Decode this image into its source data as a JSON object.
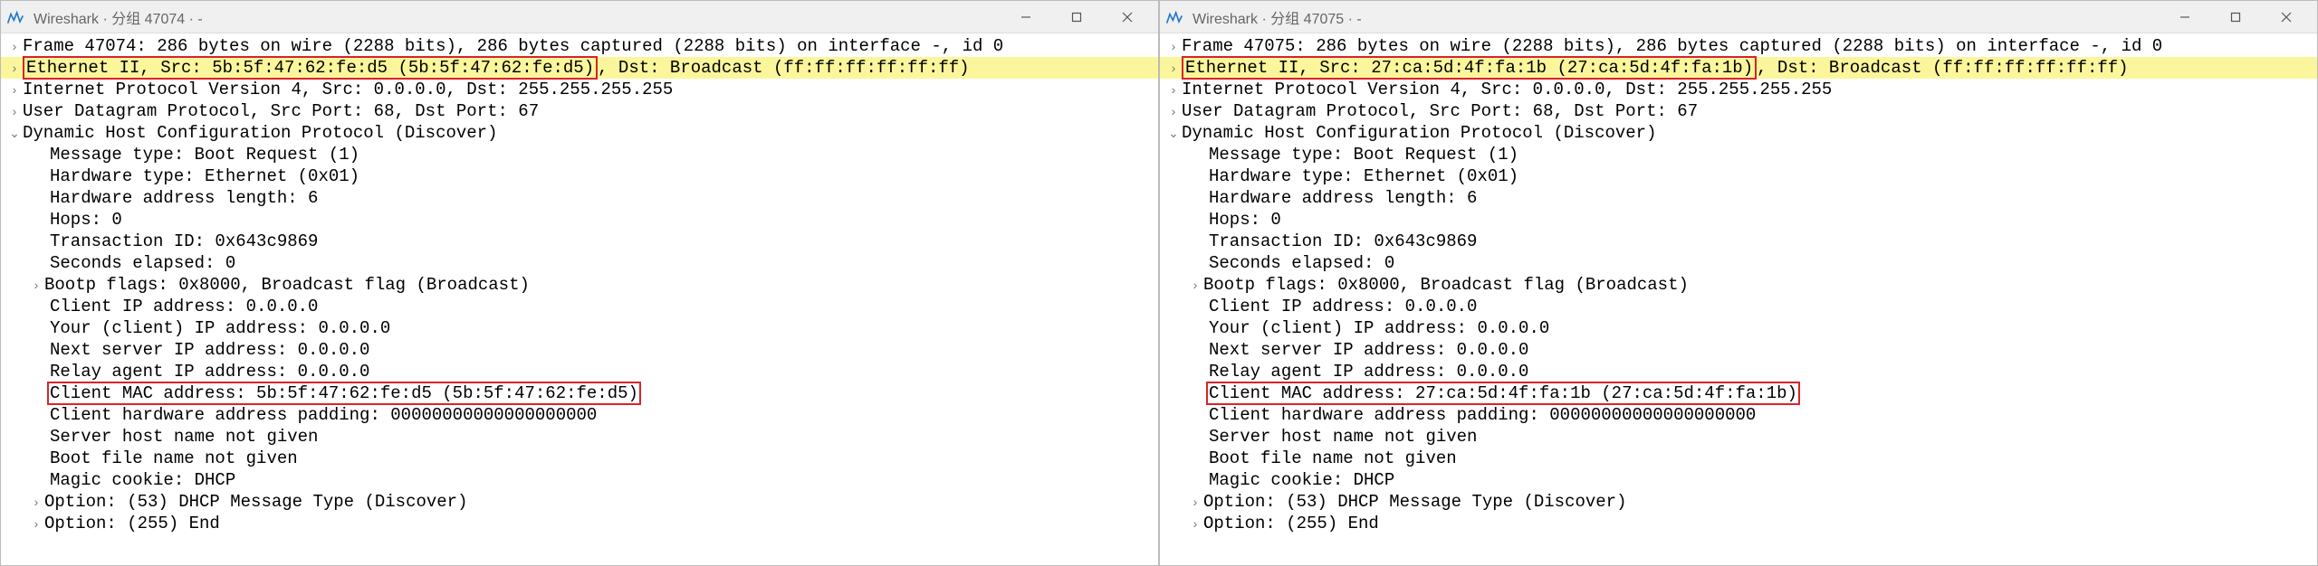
{
  "left": {
    "title": "Wireshark · 分组 47074 · -",
    "frame_line": "Frame 47074: 286 bytes on wire (2288 bits), 286 bytes captured (2288 bits) on interface -, id 0",
    "eth_prefix": "Ethernet II, Src: 5b:5f:47:62:fe:d5 (5b:5f:47:62:fe:d5)",
    "eth_suffix": ", Dst: Broadcast (ff:ff:ff:ff:ff:ff)",
    "ip_line": "Internet Protocol Version 4, Src: 0.0.0.0, Dst: 255.255.255.255",
    "udp_line": "User Datagram Protocol, Src Port: 68, Dst Port: 67",
    "dhcp_header": "Dynamic Host Configuration Protocol (Discover)",
    "msg_type": "Message type: Boot Request (1)",
    "hw_type": "Hardware type: Ethernet (0x01)",
    "hw_len": "Hardware address length: 6",
    "hops": "Hops: 0",
    "tx_id": "Transaction ID: 0x643c9869",
    "secs": "Seconds elapsed: 0",
    "bootp": "Bootp flags: 0x8000, Broadcast flag (Broadcast)",
    "client_ip": "Client IP address: 0.0.0.0",
    "your_ip": "Your (client) IP address: 0.0.0.0",
    "next_ip": "Next server IP address: 0.0.0.0",
    "relay_ip": "Relay agent IP address: 0.0.0.0",
    "client_mac": "Client MAC address: 5b:5f:47:62:fe:d5 (5b:5f:47:62:fe:d5)",
    "hw_pad": "Client hardware address padding: 00000000000000000000",
    "server_host": "Server host name not given",
    "boot_file": "Boot file name not given",
    "magic": "Magic cookie: DHCP",
    "opt53": "Option: (53) DHCP Message Type (Discover)",
    "opt255": "Option: (255) End"
  },
  "right": {
    "title": "Wireshark · 分组 47075 · -",
    "frame_line": "Frame 47075: 286 bytes on wire (2288 bits), 286 bytes captured (2288 bits) on interface -, id 0",
    "eth_prefix": "Ethernet II, Src: 27:ca:5d:4f:fa:1b (27:ca:5d:4f:fa:1b)",
    "eth_suffix": ", Dst: Broadcast (ff:ff:ff:ff:ff:ff)",
    "ip_line": "Internet Protocol Version 4, Src: 0.0.0.0, Dst: 255.255.255.255",
    "udp_line": "User Datagram Protocol, Src Port: 68, Dst Port: 67",
    "dhcp_header": "Dynamic Host Configuration Protocol (Discover)",
    "msg_type": "Message type: Boot Request (1)",
    "hw_type": "Hardware type: Ethernet (0x01)",
    "hw_len": "Hardware address length: 6",
    "hops": "Hops: 0",
    "tx_id": "Transaction ID: 0x643c9869",
    "secs": "Seconds elapsed: 0",
    "bootp": "Bootp flags: 0x8000, Broadcast flag (Broadcast)",
    "client_ip": "Client IP address: 0.0.0.0",
    "your_ip": "Your (client) IP address: 0.0.0.0",
    "next_ip": "Next server IP address: 0.0.0.0",
    "relay_ip": "Relay agent IP address: 0.0.0.0",
    "client_mac": "Client MAC address: 27:ca:5d:4f:fa:1b (27:ca:5d:4f:fa:1b)",
    "hw_pad": "Client hardware address padding: 00000000000000000000",
    "server_host": "Server host name not given",
    "boot_file": "Boot file name not given",
    "magic": "Magic cookie: DHCP",
    "opt53": "Option: (53) DHCP Message Type (Discover)",
    "opt255": "Option: (255) End"
  },
  "glyphs": {
    "collapsed": "›",
    "expanded": "⌄"
  }
}
